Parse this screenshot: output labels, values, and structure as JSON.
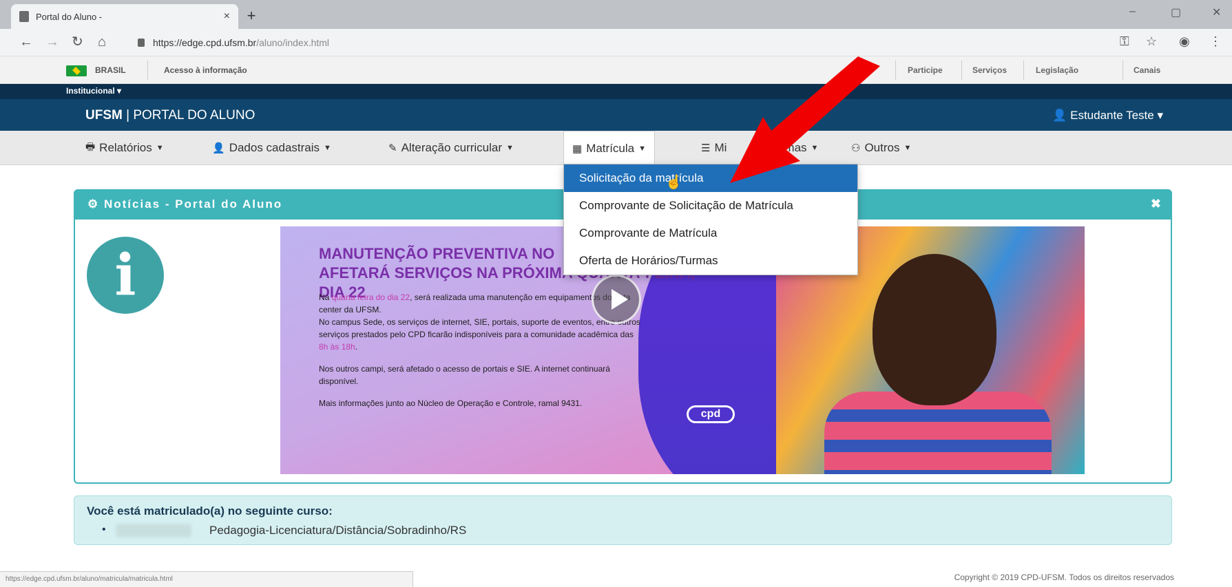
{
  "browser": {
    "tab_title": "Portal do Aluno -",
    "tab_close": "×",
    "new_tab": "+",
    "url_host": "https://edge.cpd.ufsm.br",
    "url_path": "/aluno/index.html",
    "win_minimize": "–",
    "win_maximize": "▢",
    "win_close": "✕"
  },
  "govbar": {
    "brasil": "BRASIL",
    "acesso": "Acesso à informação",
    "links": [
      "Participe",
      "Serviços",
      "Legislação",
      "Canais"
    ]
  },
  "institutional": {
    "label": "Institucional ▾"
  },
  "portal": {
    "brand_bold": "UFSM",
    "brand_rest": " | PORTAL DO ALUNO",
    "user": "Estudante Teste ▾"
  },
  "menu": {
    "items": [
      {
        "icon": "🖶",
        "label": "Relatórios"
      },
      {
        "icon": "👤",
        "label": "Dados cadastrais"
      },
      {
        "icon": "✎",
        "label": "Alteração curricular"
      },
      {
        "icon": "▦",
        "label": "Matrícula"
      },
      {
        "icon": "☰",
        "label": "Mi"
      },
      {
        "icon": "⚇",
        "label": "Outros"
      }
    ],
    "item5_tail": "mas"
  },
  "dropdown": {
    "items": [
      "Solicitação da matrícula",
      "Comprovante de Solicitação de Matrícula",
      "Comprovante de Matrícula",
      "Oferta de Horários/Turmas"
    ],
    "selected_index": 0
  },
  "news": {
    "title": "Notícias - Portal do Aluno",
    "close": "✖",
    "info_glyph": "i",
    "banner": {
      "headline_1": "MANUTENÇÃO PREVENTIVA NO",
      "headline_2": "AFETARÁ SERVIÇOS NA PRÓXIMA QUARTA-FEIRA, DIA 22",
      "p1_a": "Na ",
      "p1_pink": "quarta feira do dia 22",
      "p1_b": ", será realizada uma manutenção em equipamentos do data center da UFSM.",
      "p2_a": "No campus Sede, os serviços de internet, SIE, portais, suporte de eventos, entre outros serviços prestados pelo CPD ficarão indisponíveis para a comunidade acadêmica das ",
      "p2_pink": "8h às 18h",
      "p2_b": ".",
      "p3": "Nos outros campi, será afetado o acesso de portais e SIE. A internet continuará disponível.",
      "p4": "Mais informações junto ao Núcleo de Operação e Controle, ramal 9431.",
      "logo_text": "cpd"
    }
  },
  "course": {
    "label": "Você está matriculado(a) no seguinte curso:",
    "bullet": "•",
    "name": "Pedagogia-Licenciatura/Distância/Sobradinho/RS"
  },
  "statusbar": {
    "url": "https://edge.cpd.ufsm.br/aluno/matricula/matricula.html"
  },
  "footer": {
    "copyright": "Copyright © 2019 CPD-UFSM. Todos os direitos reservados"
  },
  "colors": {
    "accent": "#3fb4b9",
    "header": "#10466d",
    "selected": "#1f6fb8",
    "arrow": "#f00000"
  }
}
